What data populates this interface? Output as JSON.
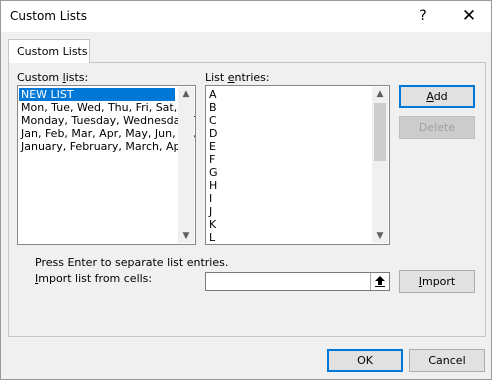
{
  "window": {
    "title": "Custom Lists",
    "help_glyph": "?",
    "close_glyph": "✕"
  },
  "tab": {
    "label": "Custom Lists"
  },
  "custom_lists": {
    "label_prefix": "Custom ",
    "label_mnemonic": "l",
    "label_suffix": "ists:",
    "items": [
      "NEW LIST",
      "Mon, Tue, Wed, Thu, Fri, Sat, Sun",
      "Monday, Tuesday, Wednesday, Thursday, Friday, Saturday, Sunday",
      "Jan, Feb, Mar, Apr, May, Jun, Jul, Aug, Sep, Oct, Nov, Dec",
      "January, February, March, April, May, June, July, August, September, October, November, December"
    ],
    "selected_index": 0
  },
  "list_entries": {
    "label_prefix": "List ",
    "label_mnemonic": "e",
    "label_suffix": "ntries:",
    "items": [
      "A",
      "B",
      "C",
      "D",
      "E",
      "F",
      "G",
      "H",
      "I",
      "J",
      "K",
      "L"
    ]
  },
  "buttons": {
    "add_mnemonic": "A",
    "add_rest": "dd",
    "delete": "Delete",
    "import_mnemonic": "I",
    "import_rest": "mport",
    "ok": "OK",
    "cancel": "Cancel"
  },
  "hint": "Press Enter to separate list entries.",
  "import": {
    "label_mnemonic": "I",
    "label_rest": "mport list from cells:",
    "value": "",
    "collapse_icon": "collapse-dialog-icon"
  },
  "colors": {
    "selection": "#0078d7",
    "default_button_border": "#0078d7"
  }
}
